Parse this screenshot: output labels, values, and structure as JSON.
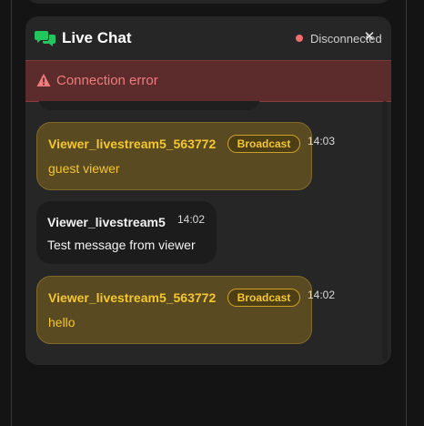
{
  "chat": {
    "title": "Live Chat",
    "status": "Disconnected",
    "close_symbol": "✕",
    "error": "Connection error"
  },
  "icons": {
    "chat": "chat-bubbles-icon",
    "warning": "warning-triangle-icon",
    "close": "close-icon"
  },
  "colors": {
    "brand_green": "#22c55e",
    "status_red": "#f26d6d",
    "error_text": "#f07b7b",
    "broadcast_gold": "#f4c72f"
  },
  "messages": [
    {
      "user": "Viewer_livestream5_563772",
      "badge": "Broadcast",
      "time": "14:03",
      "text": "guest viewer",
      "type": "broadcast"
    },
    {
      "user": "Viewer_livestream5",
      "time": "14:02",
      "text": "Test message from viewer",
      "type": "normal"
    },
    {
      "user": "Viewer_livestream5_563772",
      "badge": "Broadcast",
      "time": "14:02",
      "text": "hello",
      "type": "broadcast"
    }
  ]
}
